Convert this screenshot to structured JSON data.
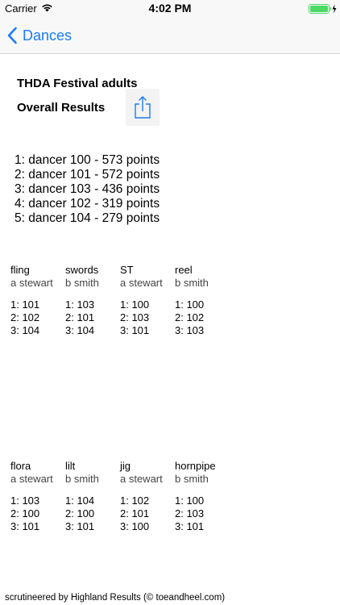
{
  "status_bar": {
    "carrier": "Carrier",
    "time": "4:02 PM"
  },
  "nav": {
    "back_label": "Dances"
  },
  "event": {
    "title": "THDA Festival adults",
    "subtitle": "Overall Results"
  },
  "overall_results": [
    "1: dancer 100 - 573 points",
    "2: dancer 101 - 572 points",
    "3: dancer 103 - 436 points",
    "4: dancer 102 - 319 points",
    "5: dancer 104 - 279 points"
  ],
  "dances": [
    {
      "name": "fling",
      "judge": "a stewart",
      "places": [
        "1: 101",
        "2: 102",
        "3: 104"
      ]
    },
    {
      "name": "swords",
      "judge": "b smith",
      "places": [
        "1: 103",
        "2: 101",
        "3: 104"
      ]
    },
    {
      "name": "ST",
      "judge": "a stewart",
      "places": [
        "1: 100",
        "2: 103",
        "3: 101"
      ]
    },
    {
      "name": "reel",
      "judge": "b smith",
      "places": [
        "1: 100",
        "2: 102",
        "3: 103"
      ]
    },
    {
      "name": "flora",
      "judge": "a stewart",
      "places": [
        "1: 103",
        "2: 100",
        "3: 101"
      ]
    },
    {
      "name": "lilt",
      "judge": "b smith",
      "places": [
        "1: 104",
        "2: 100",
        "3: 101"
      ]
    },
    {
      "name": "jig",
      "judge": "a stewart",
      "places": [
        "1: 102",
        "2: 101",
        "3: 100"
      ]
    },
    {
      "name": "hornpipe",
      "judge": "b smith",
      "places": [
        "1: 100",
        "2: 103",
        "3: 101"
      ]
    }
  ],
  "footer": "scrutineered by Highland Results (© toeandheel.com)",
  "colors": {
    "accent": "#1a7cf5",
    "battery": "#4cd964"
  }
}
